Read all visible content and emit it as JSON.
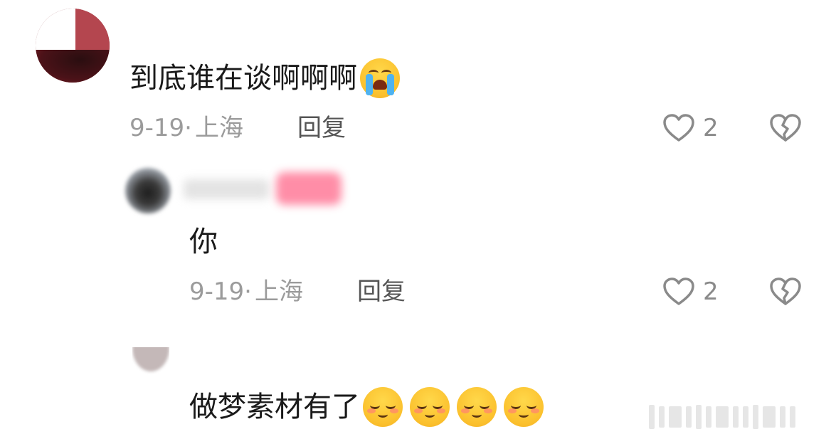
{
  "comments": [
    {
      "text": "到底谁在谈啊啊啊",
      "emoji": "loudly-crying-face-emoji",
      "date": "9-19",
      "separator": "·",
      "location": "上海",
      "reply_label": "回复",
      "like_count": "2"
    },
    {
      "text": "你",
      "date": "9-19",
      "separator": "·",
      "location": "上海",
      "reply_label": "回复",
      "like_count": "2"
    },
    {
      "text": "做梦素材有了",
      "emoji": "smiling-blushing-face-emoji",
      "emoji_count": 4
    }
  ],
  "colors": {
    "text": "#1a1a1a",
    "meta": "#9b9b9b",
    "reply": "#555555",
    "icon": "#8a8a8a",
    "tag": "#ff7a98"
  }
}
